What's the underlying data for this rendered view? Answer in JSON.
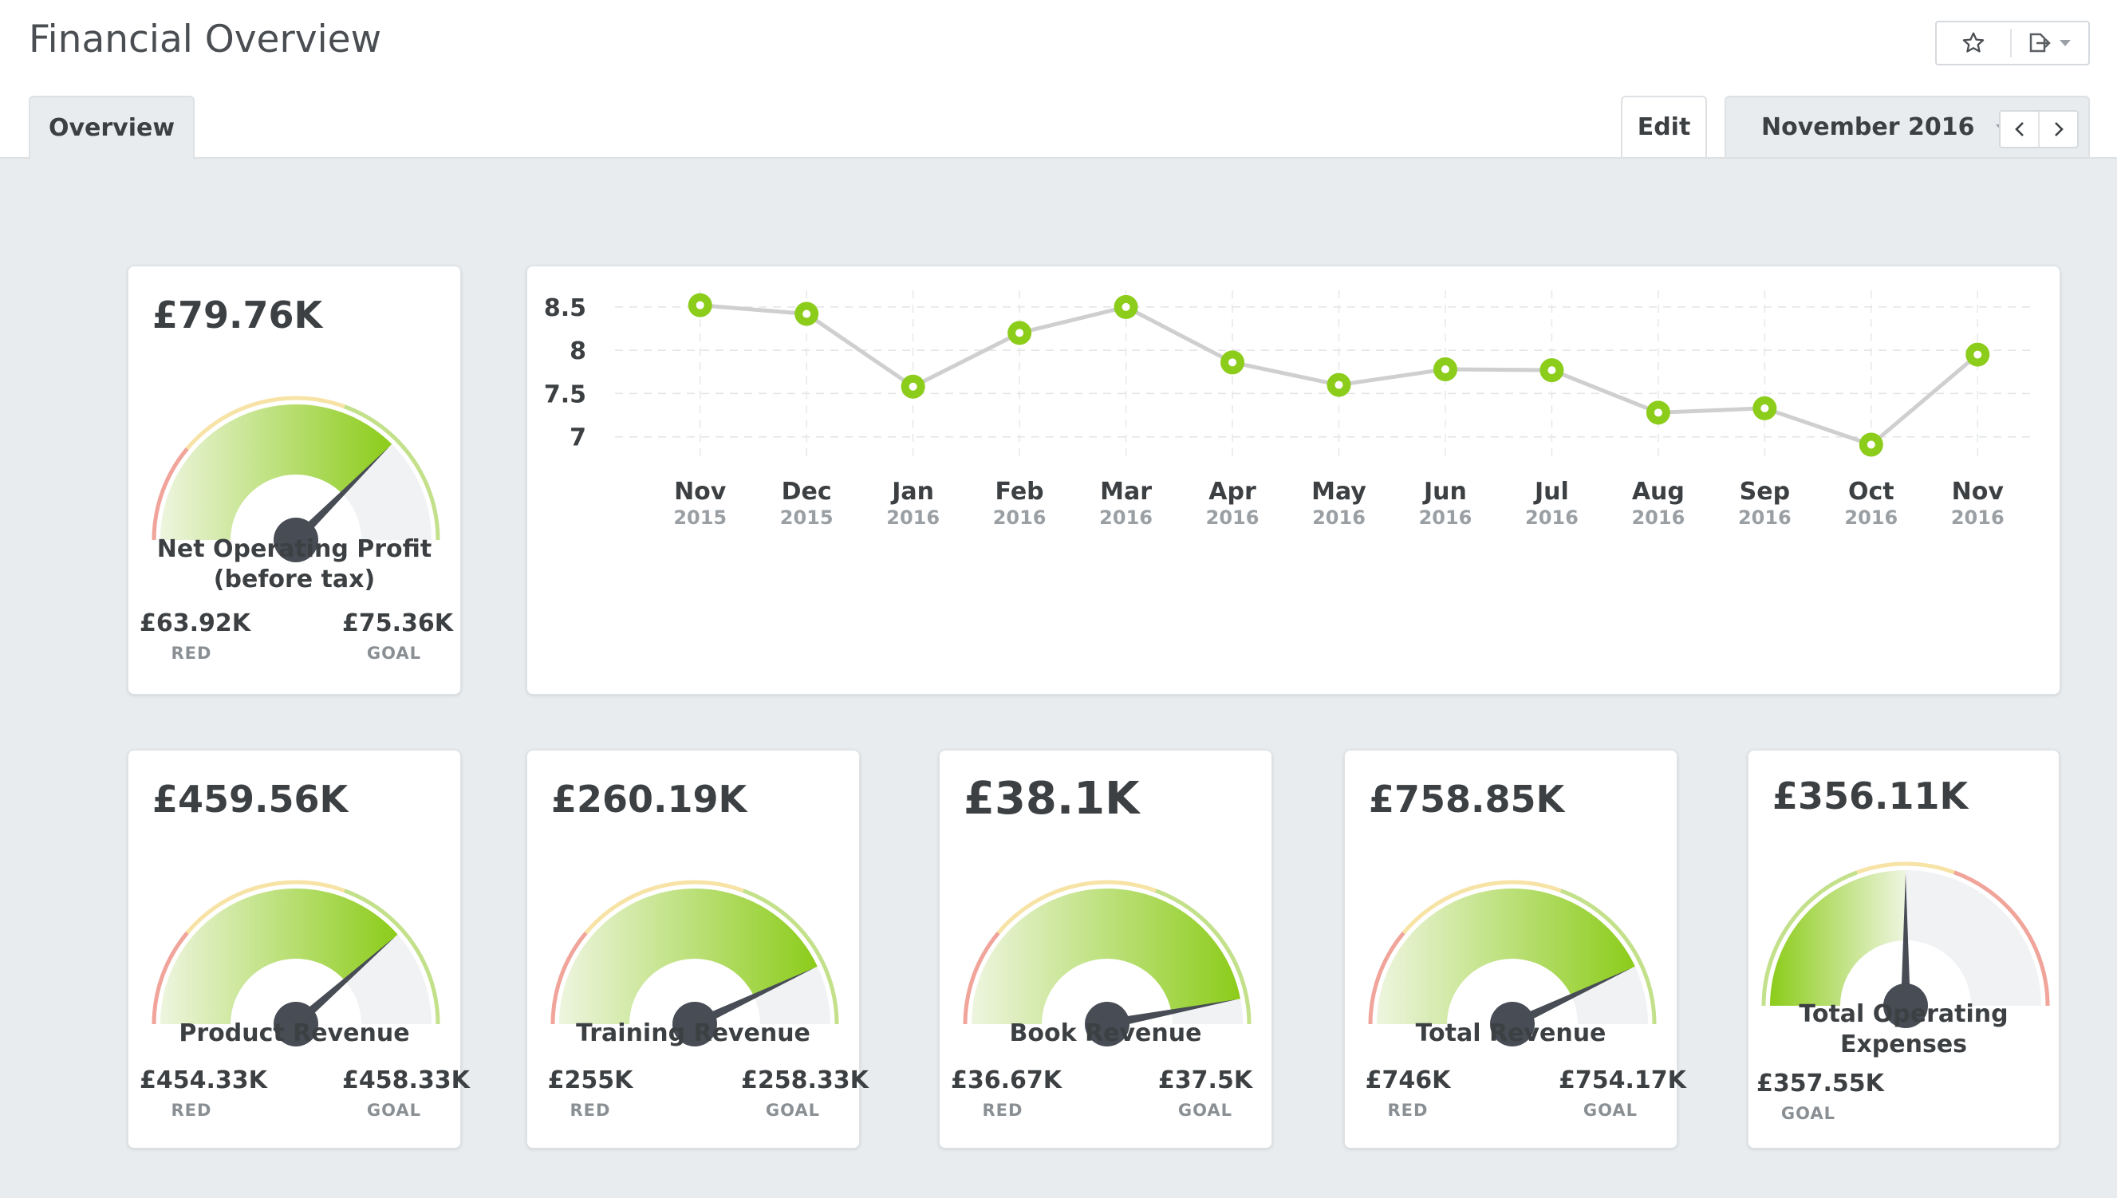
{
  "header": {
    "title": "Financial Overview",
    "tab_label": "Overview",
    "edit_label": "Edit",
    "period_label": "November 2016"
  },
  "icons": {
    "favorite": "star-icon",
    "export": "export-icon",
    "dropdown": "caret-down-icon",
    "prev": "chevron-left-icon",
    "next": "chevron-right-icon"
  },
  "colors": {
    "accent_green": "#8ccc1a",
    "gauge_red": "#f0a49a",
    "gauge_yellow": "#f7e3a5",
    "needle": "#474c55",
    "line": "#cfcfcf"
  },
  "kpis": {
    "net_operating_profit": {
      "value": "£79.76K",
      "label_line1": "Net Operating Profit",
      "label_line2": "(before tax)",
      "red": "£63.92K",
      "goal": "£75.36K",
      "red_label": "RED",
      "goal_label": "GOAL",
      "fill": 0.75
    },
    "product_revenue": {
      "value": "£459.56K",
      "label": "Product Revenue",
      "red": "£454.33K",
      "goal": "£458.33K",
      "red_label": "RED",
      "goal_label": "GOAL",
      "fill": 0.77
    },
    "training_revenue": {
      "value": "£260.19K",
      "label": "Training Revenue",
      "red": "£255K",
      "goal": "£258.33K",
      "red_label": "RED",
      "goal_label": "GOAL",
      "fill": 0.86
    },
    "book_revenue": {
      "value": "£38.1K",
      "label": "Book Revenue",
      "red": "£36.67K",
      "goal": "£37.5K",
      "red_label": "RED",
      "goal_label": "GOAL",
      "fill": 0.94
    },
    "total_revenue": {
      "value": "£758.85K",
      "label": "Total Revenue",
      "red": "£746K",
      "goal": "£754.17K",
      "red_label": "RED",
      "goal_label": "GOAL",
      "fill": 0.86
    },
    "total_operating_expenses": {
      "value": "£356.11K",
      "label_line1": "Total Operating",
      "label_line2": "Expenses",
      "goal": "£357.55K",
      "goal_label": "GOAL",
      "fill": 0.5
    }
  },
  "chart_data": {
    "type": "line",
    "categories": [
      "Nov",
      "Dec",
      "Jan",
      "Feb",
      "Mar",
      "Apr",
      "May",
      "Jun",
      "Jul",
      "Aug",
      "Sep",
      "Oct",
      "Nov"
    ],
    "years": [
      "2015",
      "2015",
      "2016",
      "2016",
      "2016",
      "2016",
      "2016",
      "2016",
      "2016",
      "2016",
      "2016",
      "2016",
      "2016"
    ],
    "values": [
      8.52,
      8.42,
      7.58,
      8.2,
      8.5,
      7.86,
      7.6,
      7.78,
      7.77,
      7.28,
      7.33,
      6.91,
      7.95
    ],
    "yticks": [
      "8.5",
      "8",
      "7.5",
      "7"
    ],
    "ylim": [
      6.85,
      8.6
    ],
    "grid": true
  }
}
